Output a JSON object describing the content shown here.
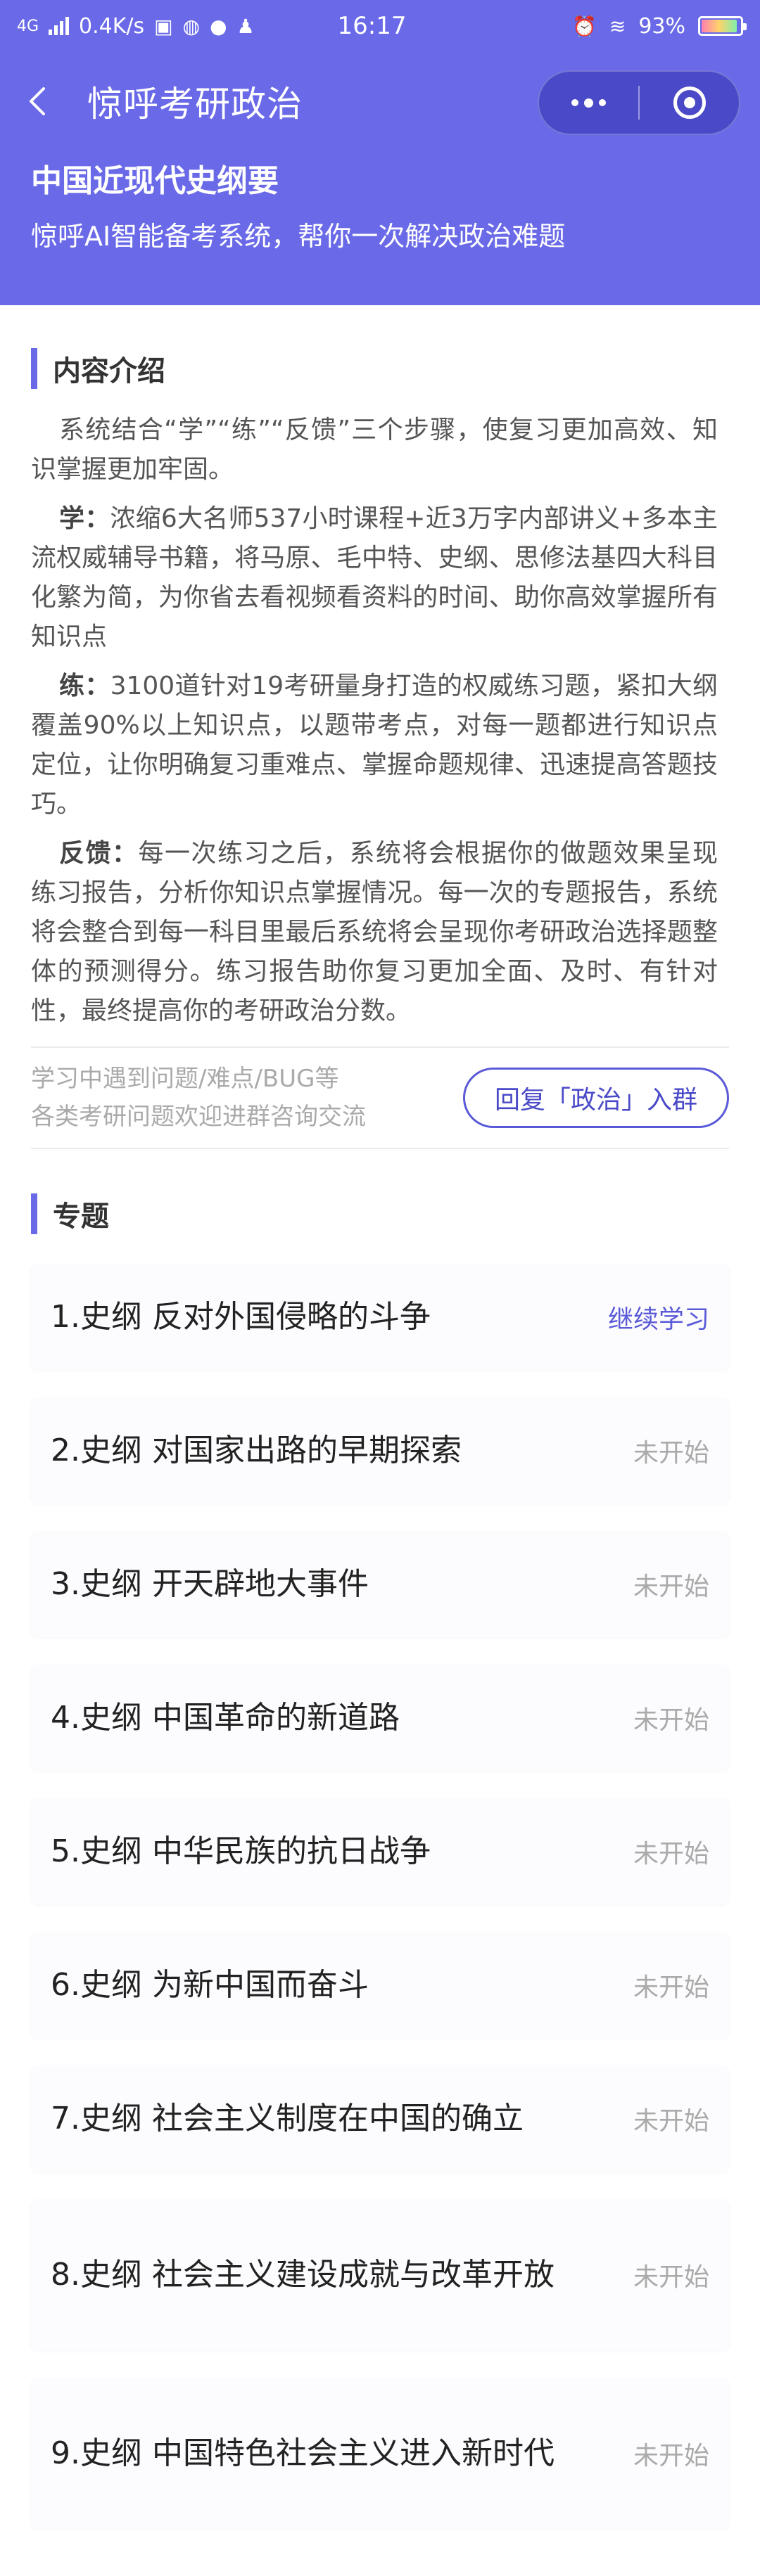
{
  "status_bar": {
    "network": "4G",
    "speed": "0.4K/s",
    "time": "16:17",
    "battery": "93%",
    "battery_level": 0.93
  },
  "nav": {
    "title": "惊呼考研政治"
  },
  "heading": {
    "title": "中国近现代史纲要",
    "subtitle": "惊呼AI智能备考系统，帮你一次解决政治难题"
  },
  "intro": {
    "section_title": "内容介绍",
    "paragraph_1": "系统结合“学”“练”“反馈”三个步骤，使复习更加高效、知识掌握更加牢固。",
    "learn_label": "学：",
    "learn_text": "浓缩6大名师537小时课程+近3万字内部讲义+多本主流权威辅导书籍，将马原、毛中特、史纲、思修法基四大科目化繁为简，为你省去看视频看资料的时间、助你高效掌握所有知识点",
    "practice_label": "练：",
    "practice_text": "3100道针对19考研量身打造的权威练习题，紧扣大纲覆盖90%以上知识点，以题带考点，对每一题都进行知识点定位，让你明确复习重难点、掌握命题规律、迅速提高答题技巧。",
    "feedback_label": "反馈：",
    "feedback_text": "每一次练习之后，系统将会根据你的做题效果呈现练习报告，分析你知识点掌握情况。每一次的专题报告，系统将会整合到每一科目里最后系统将会呈现你考研政治选择题整体的预测得分。练习报告助你复习更加全面、及时、有针对性，最终提高你的考研政治分数。"
  },
  "contact": {
    "line_1": "学习中遇到问题/难点/BUG等",
    "line_2": "各类考研问题欢迎进群咨询交流",
    "button": "回复「政治」入群"
  },
  "topics": {
    "section_title": "专题",
    "items": [
      {
        "name": "1.史纲 反对外国侵略的斗争",
        "status": "继续学习"
      },
      {
        "name": "2.史纲 对国家出路的早期探索",
        "status": "未开始"
      },
      {
        "name": "3.史纲 开天辟地大事件",
        "status": "未开始"
      },
      {
        "name": "4.史纲 中国革命的新道路",
        "status": "未开始"
      },
      {
        "name": "5.史纲 中华民族的抗日战争",
        "status": "未开始"
      },
      {
        "name": "6.史纲 为新中国而奋斗",
        "status": "未开始"
      },
      {
        "name": "7.史纲 社会主义制度在中国的确立",
        "status": "未开始"
      },
      {
        "name": "8.史纲 社会主义建设成就与改革开放",
        "status": "未开始"
      },
      {
        "name": "9.史纲 中国特色社会主义进入新时代",
        "status": "未开始"
      }
    ]
  },
  "colors": {
    "brand": "#6a6ae8",
    "accent": "#5a5ad8",
    "muted": "#aaaaaa"
  }
}
